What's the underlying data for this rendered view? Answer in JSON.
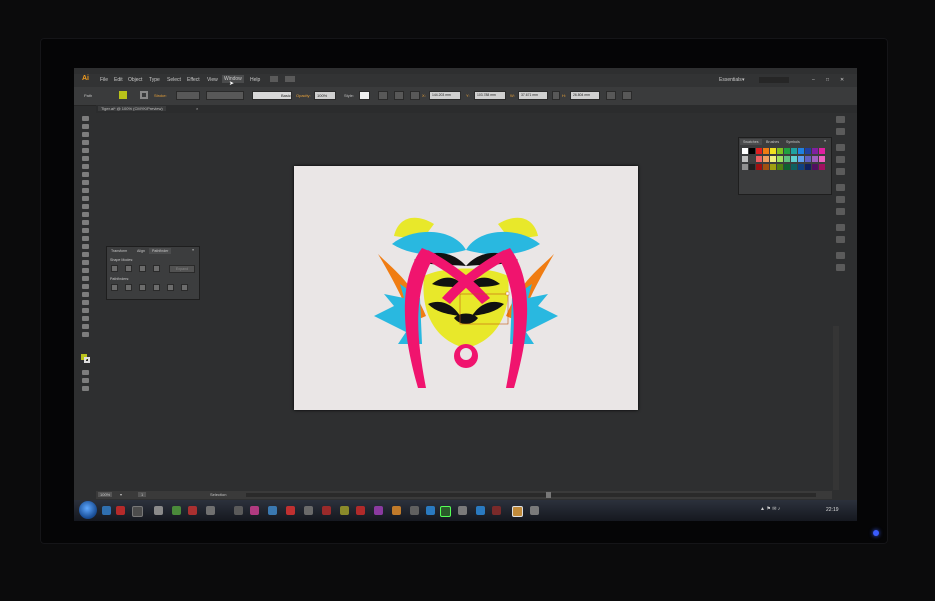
{
  "app": {
    "logo": "Ai"
  },
  "menu": {
    "items": [
      "File",
      "Edit",
      "Object",
      "Type",
      "Select",
      "Effect",
      "View",
      "Window",
      "Help"
    ],
    "workspace": "Essentials"
  },
  "control_bar": {
    "object_type": "Path",
    "stroke_label": "Stroke:",
    "brush_label": "Basic",
    "opacity_label": "Opacity:",
    "opacity_value": "100%",
    "style_label": "Style:",
    "x_value": "144.203 mm",
    "y_value": "103.788 mm",
    "w_value": "37.671 mm",
    "h_value": "26.804 mm"
  },
  "document_tab": {
    "title": "Tiger.ai* @ 100% (CMYK/Preview)"
  },
  "pathfinder_panel": {
    "tabs": [
      "Transform",
      "Align",
      "Pathfinder"
    ],
    "shape_modes_label": "Shape Modes:",
    "expand_label": "Expand",
    "pathfinders_label": "Pathfinders:"
  },
  "swatches_panel": {
    "tabs": [
      "Swatches",
      "Brushes",
      "Symbols"
    ]
  },
  "status_bar": {
    "zoom": "100%",
    "page": "1",
    "tool": "Selection"
  },
  "taskbar": {
    "clock": "22:19"
  },
  "colors": {
    "cyan": "#29b8e0",
    "magenta": "#f0146e",
    "yellow": "#e8e82a",
    "orange": "#f07c12",
    "black": "#111111",
    "fill_swatch": "#b9c21a"
  }
}
